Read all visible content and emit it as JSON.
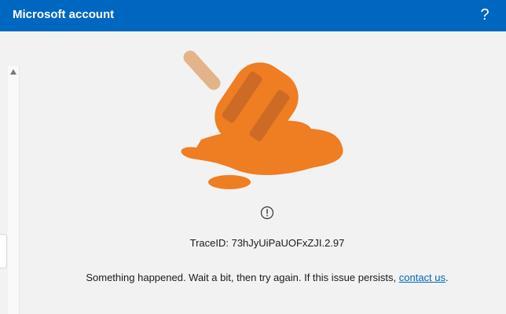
{
  "window": {
    "title": "Microsoft account",
    "help_label": "?"
  },
  "error": {
    "trace_label": "TraceID: 73hJyUiPaUOFxZJI.2.97",
    "message_text": "Something happened. Wait a bit, then try again. If this issue persists, ",
    "link_text": "contact us",
    "message_end": "."
  },
  "colors": {
    "titlebar": "#0067c0",
    "popsicle": "#ef7d22",
    "link": "#0067b8"
  },
  "icons": {
    "help": "question-mark-icon",
    "warning": "exclamation-circle-icon",
    "illustration": "melted-popsicle-illustration"
  }
}
